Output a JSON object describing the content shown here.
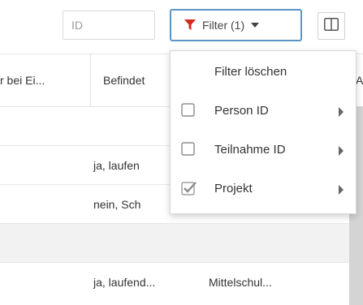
{
  "toolbar": {
    "search_placeholder": "ID",
    "filter_label": "Filter (1)",
    "icons": {
      "filter": "funnel-icon",
      "caret": "caret-down-icon",
      "columns": "columns-icon"
    },
    "colors": {
      "filter_border": "#5b95c9",
      "funnel": "#d42a1e"
    }
  },
  "table": {
    "headers": [
      {
        "label": "r bei Ei..."
      },
      {
        "label": "Befindet"
      },
      {
        "label": "A"
      }
    ],
    "rows": [
      {
        "cells": [
          "",
          ""
        ],
        "style": "white"
      },
      {
        "cells": [
          "ja, laufen",
          ""
        ],
        "style": "white"
      },
      {
        "cells": [
          "nein, Sch",
          ""
        ],
        "style": "white"
      },
      {
        "cells": [
          "",
          ""
        ],
        "style": "grey"
      },
      {
        "cells": [
          "ja, laufend...",
          "Mittelschul..."
        ],
        "style": "white"
      }
    ]
  },
  "menu": {
    "clear_label": "Filter löschen",
    "items": [
      {
        "label": "Person ID",
        "checked": false
      },
      {
        "label": "Teilnahme ID",
        "checked": false
      },
      {
        "label": "Projekt",
        "checked": true
      }
    ]
  }
}
